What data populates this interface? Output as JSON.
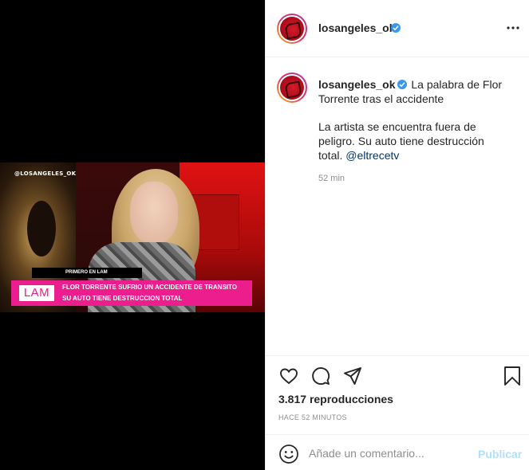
{
  "post": {
    "username": "losangeles_ok",
    "verified": true,
    "more_icon": "more-horizontal-icon"
  },
  "media": {
    "watermark": "@LOSANGELES_OK",
    "program_tag": "PRIMERO EN LAM",
    "logo_text": "LAM",
    "headline_line1": "FLOR TORRENTE SUFRIO UN ACCIDENTE DE TRANSITO",
    "headline_line2": "SU AUTO TIENE DESTRUCCION TOTAL",
    "accent_color": "#ec1d8c"
  },
  "caption": {
    "username": "losangeles_ok",
    "title_text": "La palabra de Flor Torrente tras el accidente",
    "body_text": "La artista se encuentra fuera de peligro. Su auto tiene destrucción total.",
    "mention": "@eltrecetv",
    "time": "52 min"
  },
  "actions": {
    "icons": [
      "heart-icon",
      "comment-icon",
      "share-icon",
      "bookmark-icon"
    ],
    "views_count": "3.817",
    "views_label": "reproducciones",
    "posted_ago": "HACE 52 MINUTOS"
  },
  "comment": {
    "placeholder": "Añade un comentario...",
    "publish_label": "Publicar",
    "publish_color": "#b2dffc"
  }
}
